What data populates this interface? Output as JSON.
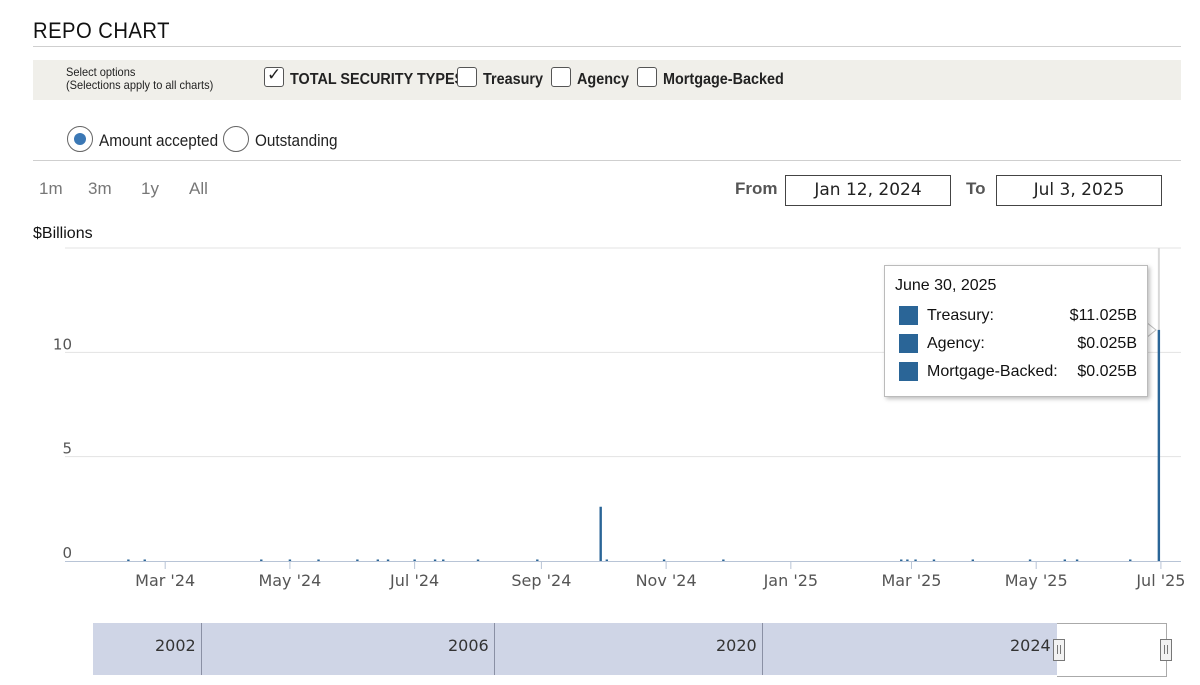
{
  "page": {
    "title": "REPO CHART"
  },
  "options": {
    "label_line1": "Select options",
    "label_line2": "(Selections apply to all charts)",
    "checkboxes": [
      {
        "label": "TOTAL SECURITY TYPES",
        "checked": true
      },
      {
        "label": "Treasury",
        "checked": false
      },
      {
        "label": "Agency",
        "checked": false
      },
      {
        "label": "Mortgage-Backed",
        "checked": false
      }
    ]
  },
  "radios": [
    {
      "label": "Amount accepted",
      "selected": true
    },
    {
      "label": "Outstanding",
      "selected": false
    }
  ],
  "range_buttons": [
    "1m",
    "3m",
    "1y",
    "All"
  ],
  "date_range": {
    "from_label": "From",
    "from_value": "Jan 12, 2024",
    "to_label": "To",
    "to_value": "Jul 3, 2025"
  },
  "colors": {
    "series": "#2a6597",
    "grid": "#e3e3e3",
    "navigator": "#cfd5e6"
  },
  "chart_data": {
    "type": "bar",
    "ylabel": "$Billions",
    "ylim": [
      0,
      15
    ],
    "y_ticks": [
      0,
      5,
      10
    ],
    "x_range": [
      "2024-01-12",
      "2025-07-03"
    ],
    "x_ticks": [
      {
        "date": "2024-03-01",
        "label": "Mar '24"
      },
      {
        "date": "2024-05-01",
        "label": "May '24"
      },
      {
        "date": "2024-07-01",
        "label": "Jul '24"
      },
      {
        "date": "2024-09-01",
        "label": "Sep '24"
      },
      {
        "date": "2024-11-01",
        "label": "Nov '24"
      },
      {
        "date": "2025-01-01",
        "label": "Jan '25"
      },
      {
        "date": "2025-03-01",
        "label": "Mar '25"
      },
      {
        "date": "2025-05-01",
        "label": "May '25"
      },
      {
        "date": "2025-07-01",
        "label": "Jul '25"
      }
    ],
    "grid": true,
    "series": [
      {
        "points": [
          {
            "date": "2024-02-12",
            "value": 0.05
          },
          {
            "date": "2024-02-20",
            "value": 0.05
          },
          {
            "date": "2024-04-17",
            "value": 0.05
          },
          {
            "date": "2024-05-01",
            "value": 0.05
          },
          {
            "date": "2024-05-15",
            "value": 0.05
          },
          {
            "date": "2024-06-03",
            "value": 0.05
          },
          {
            "date": "2024-06-13",
            "value": 0.05
          },
          {
            "date": "2024-06-18",
            "value": 0.05
          },
          {
            "date": "2024-07-01",
            "value": 0.05
          },
          {
            "date": "2024-07-11",
            "value": 0.05
          },
          {
            "date": "2024-07-15",
            "value": 0.05
          },
          {
            "date": "2024-08-01",
            "value": 0.05
          },
          {
            "date": "2024-08-30",
            "value": 0.05
          },
          {
            "date": "2024-09-30",
            "value": 2.6
          },
          {
            "date": "2024-10-03",
            "value": 0.05
          },
          {
            "date": "2024-10-31",
            "value": 0.05
          },
          {
            "date": "2024-11-29",
            "value": 0.05
          },
          {
            "date": "2025-02-24",
            "value": 0.05
          },
          {
            "date": "2025-02-27",
            "value": 0.05
          },
          {
            "date": "2025-03-03",
            "value": 0.05
          },
          {
            "date": "2025-03-12",
            "value": 0.05
          },
          {
            "date": "2025-03-31",
            "value": 0.05
          },
          {
            "date": "2025-04-28",
            "value": 0.05
          },
          {
            "date": "2025-05-15",
            "value": 0.05
          },
          {
            "date": "2025-05-21",
            "value": 0.05
          },
          {
            "date": "2025-06-16",
            "value": 0.05
          },
          {
            "date": "2025-06-30",
            "value": 11.075
          }
        ]
      }
    ],
    "tooltip": {
      "date": "June 30, 2025",
      "rows": [
        {
          "name": "Treasury:",
          "value": "$11.025B"
        },
        {
          "name": "Agency:",
          "value": "$0.025B"
        },
        {
          "name": "Mortgage-Backed:",
          "value": "$0.025B"
        }
      ]
    },
    "navigator_labels": [
      "2002",
      "2006",
      "2020",
      "2024"
    ]
  }
}
